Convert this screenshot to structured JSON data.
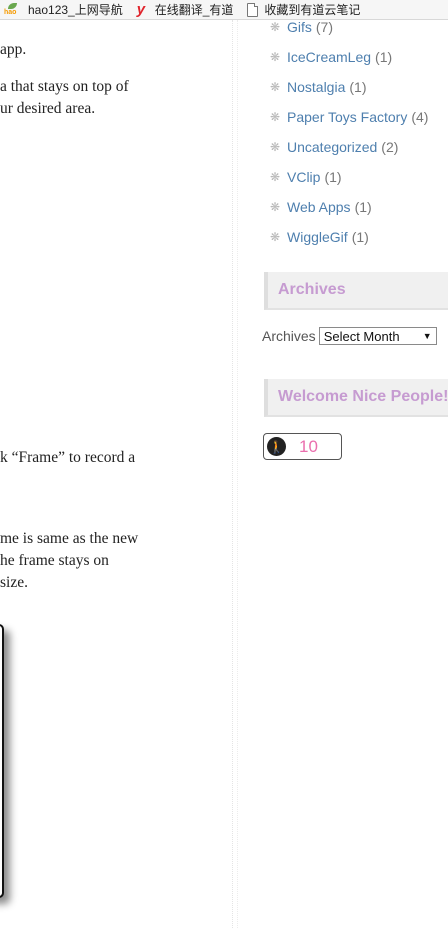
{
  "bookmarks": [
    {
      "icon": "hao123-icon",
      "label": "hao123_上网导航"
    },
    {
      "icon": "youdao-y-icon",
      "label": "在线翻译_有道"
    },
    {
      "icon": "page-icon",
      "label": "收藏到有道云笔记"
    }
  ],
  "article": {
    "lines": [
      "app.",
      "a that stays on top of",
      "ur desired area.",
      "k “Frame” to record a",
      "me is same as the new",
      "he frame stays on",
      "size."
    ]
  },
  "sidebar": {
    "categories": [
      {
        "name": "Gifs",
        "count": "(7)"
      },
      {
        "name": "IceCreamLeg",
        "count": "(1)"
      },
      {
        "name": "Nostalgia",
        "count": "(1)"
      },
      {
        "name": "Paper Toys Factory",
        "count": "(4)"
      },
      {
        "name": "Uncategorized",
        "count": "(2)"
      },
      {
        "name": "VClip",
        "count": "(1)"
      },
      {
        "name": "Web Apps",
        "count": "(1)"
      },
      {
        "name": "WiggleGif",
        "count": "(1)"
      }
    ],
    "archives_title": "Archives",
    "archives_label": "Archives",
    "archives_select": "Select Month",
    "welcome_title": "Welcome Nice People!",
    "visitor_count": "10"
  },
  "colors": {
    "link": "#4e7fae",
    "widget_title": "#c69bd1",
    "counter": "#ea6fae"
  }
}
